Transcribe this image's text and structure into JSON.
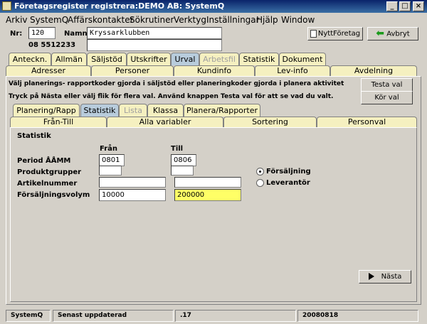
{
  "window": {
    "title": "Företagsregister registrera:DEMO AB: SystemQ"
  },
  "menu": [
    "Arkiv",
    "SystemQ",
    "Affärskontakter",
    "Sökrutiner",
    "Verktyg",
    "Inställningar",
    "Hjälp",
    "Window"
  ],
  "header": {
    "nr_label": "Nr:",
    "nr_value": "120",
    "namn_label": "Namn:",
    "namn_value": "Kryssarklubben",
    "phone": "08 5512233",
    "new_company_label": "NyttFöretag",
    "cancel_label": "Avbryt"
  },
  "tabs_row1": [
    "Anteckn.",
    "Allmän",
    "Säljstöd",
    "Utskrifter",
    "Urval",
    "Arbetsfil",
    "Statistik",
    "Dokument"
  ],
  "tabs_row2": [
    "Adresser",
    "Personer",
    "Kundinfo",
    "Lev-info",
    "Avdelning"
  ],
  "info": {
    "line1": "Välj planerings- rapportkoder gjorda i säljstöd eller planeringkoder gjorda i planera aktivitet",
    "line2": "Tryck på Nästa eller välj flik för flera val. Använd knappen Testa val för att se vad du valt.",
    "test_label": "Testa val",
    "run_label": "Kör val"
  },
  "subtabs_row1": [
    "Planering/Rapp",
    "Statistik",
    "Lista",
    "Klassa",
    "Planera/Rapporter"
  ],
  "subtabs_row2": [
    "Från-Till",
    "Alla variabler",
    "Sortering",
    "Personval"
  ],
  "statistik": {
    "heading": "Statistik",
    "from_header": "Från",
    "to_header": "Till",
    "rows": [
      {
        "label": "Period ÅÅMM",
        "from": "0801",
        "to": "0806"
      },
      {
        "label": "Produktgrupper",
        "from": "",
        "to": ""
      },
      {
        "label": "Artikelnummer",
        "from": "",
        "to": ""
      },
      {
        "label": "Försäljningsvolym",
        "from": "10000",
        "to": "200000"
      }
    ],
    "radio_sales": "Försäljning",
    "radio_supplier": "Leverantör",
    "next_label": "Nästa"
  },
  "statusbar": [
    "SystemQ",
    "Senast uppdaterad",
    ".17",
    "20080818"
  ],
  "colors": {
    "tab": "#f5f0c0",
    "selected_tab": "#b8ccdc",
    "highlight_field": "#ffff66",
    "title": "#0a246a"
  }
}
